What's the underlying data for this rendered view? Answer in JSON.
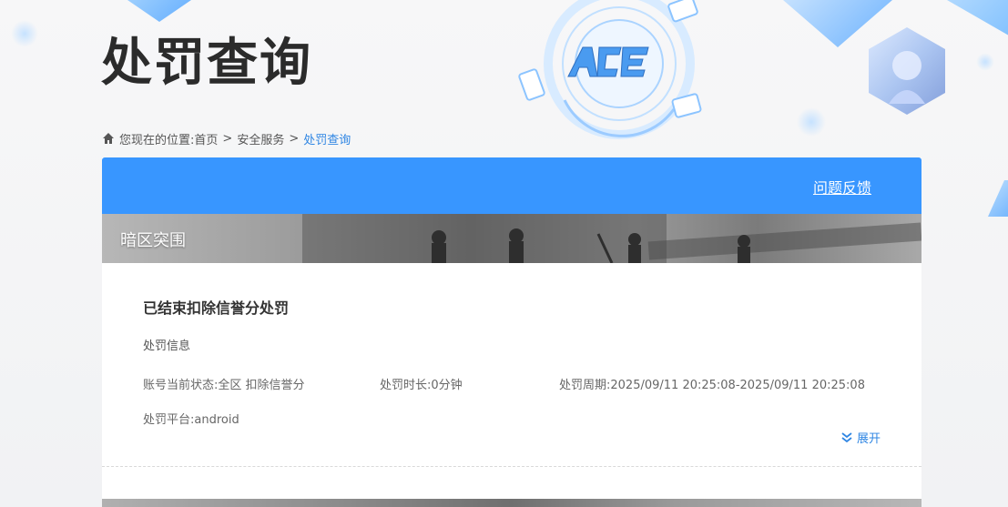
{
  "header": {
    "title": "处罚查询",
    "logo_text": "ACE"
  },
  "breadcrumb": {
    "prefix": "您现在的位置:",
    "items": [
      "首页",
      "安全服务",
      "处罚查询"
    ],
    "separator": ">"
  },
  "card": {
    "feedback_label": "问题反馈",
    "accent_color": "#3896ff",
    "game": {
      "name": "暗区突围"
    },
    "record": {
      "title": "已结束扣除信誉分处罚",
      "section_label": "处罚信息",
      "status": "账号当前状态:全区 扣除信誉分",
      "duration": "处罚时长:0分钟",
      "period": "处罚周期:2025/09/11 20:25:08-2025/09/11 20:25:08",
      "platform": "处罚平台:android",
      "expand_label": "展开"
    }
  },
  "icons": {
    "home": "home-icon",
    "expand": "double-chevron-down-icon"
  }
}
